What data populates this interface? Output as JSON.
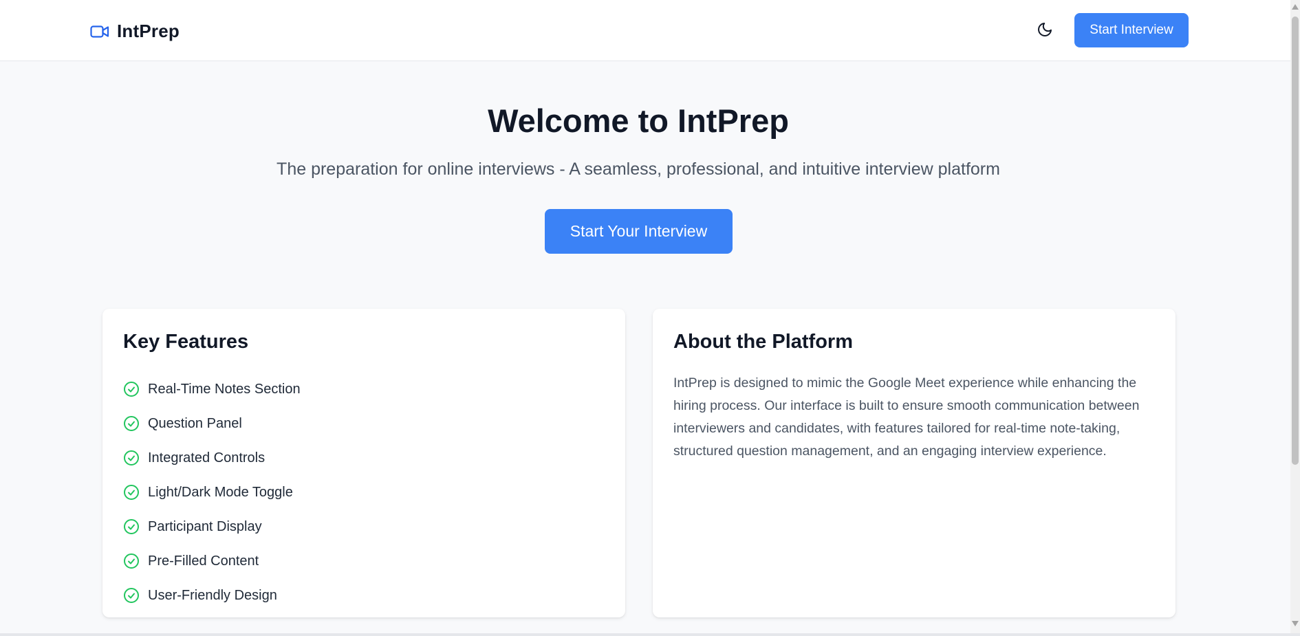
{
  "header": {
    "brand_name": "IntPrep",
    "brand_icon": "video-camera-icon",
    "theme_toggle_icon": "moon-icon",
    "cta_label": "Start Interview"
  },
  "hero": {
    "title": "Welcome to IntPrep",
    "subtitle": "The preparation for online interviews - A seamless, professional, and intuitive interview platform",
    "cta_label": "Start Your Interview"
  },
  "features": {
    "title": "Key Features",
    "item_icon": "check-circle-icon",
    "items": [
      {
        "label": "Real-Time Notes Section"
      },
      {
        "label": "Question Panel"
      },
      {
        "label": "Integrated Controls"
      },
      {
        "label": "Light/Dark Mode Toggle"
      },
      {
        "label": "Participant Display"
      },
      {
        "label": "Pre-Filled Content"
      },
      {
        "label": "User-Friendly Design"
      }
    ]
  },
  "about": {
    "title": "About the Platform",
    "body": "IntPrep is designed to mimic the Google Meet experience while enhancing the hiring process. Our interface is built to ensure smooth communication between interviewers and candidates, with features tailored for real-time note-taking, structured question management, and an engaging interview experience."
  },
  "colors": {
    "accent": "#3b82f6",
    "brand_icon": "#2563eb",
    "check": "#22c55e",
    "background": "#f8f9fb",
    "card": "#ffffff",
    "heading": "#111827",
    "body_text": "#4b5563"
  }
}
